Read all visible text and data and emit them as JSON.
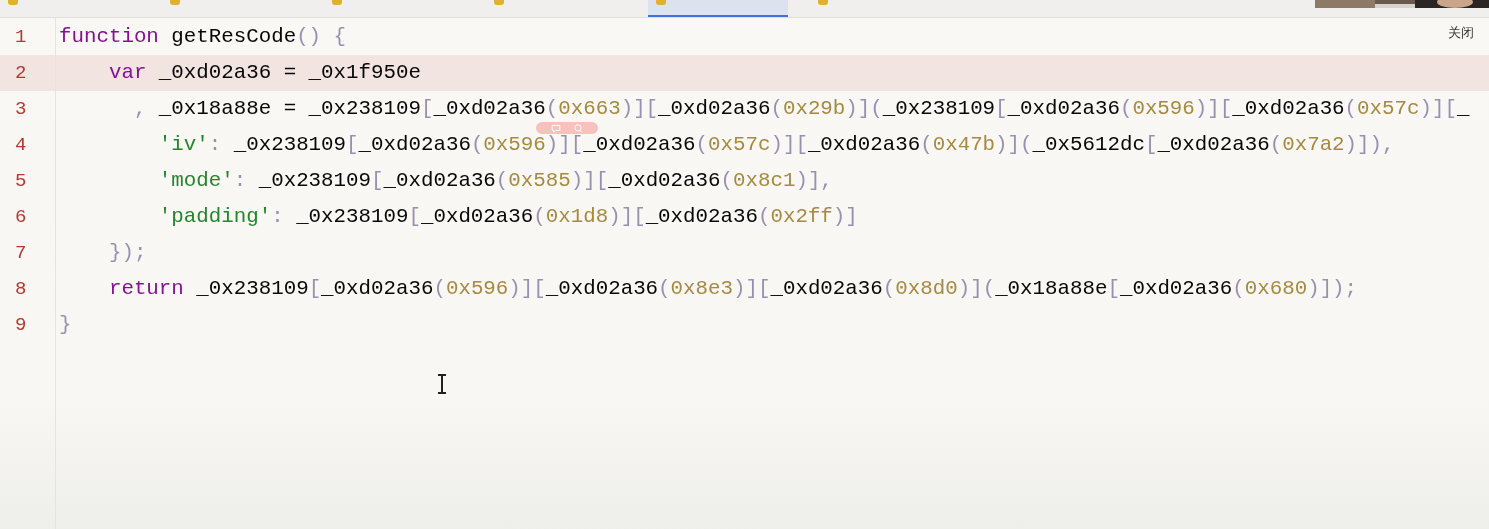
{
  "tabs": [
    {
      "selected": false
    },
    {
      "selected": false
    },
    {
      "selected": false
    },
    {
      "selected": false
    },
    {
      "selected": true
    },
    {
      "selected": false
    }
  ],
  "close_label": "关闭",
  "editor": {
    "lines": [
      {
        "number": "1",
        "current": false,
        "tokens": [
          {
            "kind": "keyword",
            "text": "function"
          },
          {
            "kind": "ident",
            "text": " getResCode"
          },
          {
            "kind": "punct",
            "text": "() {"
          }
        ]
      },
      {
        "number": "2",
        "current": true,
        "tokens": [
          {
            "kind": "keyword",
            "text": "    var"
          },
          {
            "kind": "ident",
            "text": " _0xd02a36 = _0x1f950e"
          }
        ]
      },
      {
        "number": "3",
        "current": false,
        "tokens": [
          {
            "kind": "punct",
            "text": "      ,"
          },
          {
            "kind": "ident",
            "text": " _0x18a88e = _0x238109"
          },
          {
            "kind": "punct",
            "text": "["
          },
          {
            "kind": "ident",
            "text": "_0xd02a36"
          },
          {
            "kind": "punct",
            "text": "("
          },
          {
            "kind": "number",
            "text": "0x663"
          },
          {
            "kind": "punct",
            "text": ")]["
          },
          {
            "kind": "ident",
            "text": "_0xd02a36"
          },
          {
            "kind": "punct",
            "text": "("
          },
          {
            "kind": "number",
            "text": "0x29b"
          },
          {
            "kind": "punct",
            "text": ")]("
          },
          {
            "kind": "ident",
            "text": "_0x238109"
          },
          {
            "kind": "punct",
            "text": "["
          },
          {
            "kind": "ident",
            "text": "_0xd02a36"
          },
          {
            "kind": "punct",
            "text": "("
          },
          {
            "kind": "number",
            "text": "0x596"
          },
          {
            "kind": "punct",
            "text": ")]["
          },
          {
            "kind": "ident",
            "text": "_0xd02a36"
          },
          {
            "kind": "punct",
            "text": "("
          },
          {
            "kind": "number",
            "text": "0x57c"
          },
          {
            "kind": "punct",
            "text": ")]["
          },
          {
            "kind": "ident",
            "text": "_"
          }
        ]
      },
      {
        "number": "4",
        "current": false,
        "tokens": [
          {
            "kind": "string",
            "text": "        'iv'"
          },
          {
            "kind": "punct",
            "text": ":"
          },
          {
            "kind": "ident",
            "text": " _0x238109"
          },
          {
            "kind": "punct",
            "text": "["
          },
          {
            "kind": "ident",
            "text": "_0xd02a36"
          },
          {
            "kind": "punct",
            "text": "("
          },
          {
            "kind": "number",
            "text": "0x596"
          },
          {
            "kind": "punct",
            "text": ")]["
          },
          {
            "kind": "ident",
            "text": "_0xd02a36"
          },
          {
            "kind": "punct",
            "text": "("
          },
          {
            "kind": "number",
            "text": "0x57c"
          },
          {
            "kind": "punct",
            "text": ")]["
          },
          {
            "kind": "ident",
            "text": "_0xd02a36"
          },
          {
            "kind": "punct",
            "text": "("
          },
          {
            "kind": "number",
            "text": "0x47b"
          },
          {
            "kind": "punct",
            "text": ")]("
          },
          {
            "kind": "ident",
            "text": "_0x5612dc"
          },
          {
            "kind": "punct",
            "text": "["
          },
          {
            "kind": "ident",
            "text": "_0xd02a36"
          },
          {
            "kind": "punct",
            "text": "("
          },
          {
            "kind": "number",
            "text": "0x7a2"
          },
          {
            "kind": "punct",
            "text": ")]),"
          }
        ]
      },
      {
        "number": "5",
        "current": false,
        "tokens": [
          {
            "kind": "string",
            "text": "        'mode'"
          },
          {
            "kind": "punct",
            "text": ":"
          },
          {
            "kind": "ident",
            "text": " _0x238109"
          },
          {
            "kind": "punct",
            "text": "["
          },
          {
            "kind": "ident",
            "text": "_0xd02a36"
          },
          {
            "kind": "punct",
            "text": "("
          },
          {
            "kind": "number",
            "text": "0x585"
          },
          {
            "kind": "punct",
            "text": ")]["
          },
          {
            "kind": "ident",
            "text": "_0xd02a36"
          },
          {
            "kind": "punct",
            "text": "("
          },
          {
            "kind": "number",
            "text": "0x8c1"
          },
          {
            "kind": "punct",
            "text": ")],"
          }
        ]
      },
      {
        "number": "6",
        "current": false,
        "tokens": [
          {
            "kind": "string",
            "text": "        'padding'"
          },
          {
            "kind": "punct",
            "text": ":"
          },
          {
            "kind": "ident",
            "text": " _0x238109"
          },
          {
            "kind": "punct",
            "text": "["
          },
          {
            "kind": "ident",
            "text": "_0xd02a36"
          },
          {
            "kind": "punct",
            "text": "("
          },
          {
            "kind": "number",
            "text": "0x1d8"
          },
          {
            "kind": "punct",
            "text": ")]["
          },
          {
            "kind": "ident",
            "text": "_0xd02a36"
          },
          {
            "kind": "punct",
            "text": "("
          },
          {
            "kind": "number",
            "text": "0x2ff"
          },
          {
            "kind": "punct",
            "text": ")]"
          }
        ]
      },
      {
        "number": "7",
        "current": false,
        "tokens": [
          {
            "kind": "punct",
            "text": "    });"
          }
        ]
      },
      {
        "number": "8",
        "current": false,
        "tokens": [
          {
            "kind": "keyword",
            "text": "    return"
          },
          {
            "kind": "ident",
            "text": " _0x238109"
          },
          {
            "kind": "punct",
            "text": "["
          },
          {
            "kind": "ident",
            "text": "_0xd02a36"
          },
          {
            "kind": "punct",
            "text": "("
          },
          {
            "kind": "number",
            "text": "0x596"
          },
          {
            "kind": "punct",
            "text": ")]["
          },
          {
            "kind": "ident",
            "text": "_0xd02a36"
          },
          {
            "kind": "punct",
            "text": "("
          },
          {
            "kind": "number",
            "text": "0x8e3"
          },
          {
            "kind": "punct",
            "text": ")]["
          },
          {
            "kind": "ident",
            "text": "_0xd02a36"
          },
          {
            "kind": "punct",
            "text": "("
          },
          {
            "kind": "number",
            "text": "0x8d0"
          },
          {
            "kind": "punct",
            "text": ")]("
          },
          {
            "kind": "ident",
            "text": "_0x18a88e"
          },
          {
            "kind": "punct",
            "text": "["
          },
          {
            "kind": "ident",
            "text": "_0xd02a36"
          },
          {
            "kind": "punct",
            "text": "("
          },
          {
            "kind": "number",
            "text": "0x680"
          },
          {
            "kind": "punct",
            "text": ")]);"
          }
        ]
      },
      {
        "number": "9",
        "current": false,
        "tokens": [
          {
            "kind": "punct",
            "text": "}"
          }
        ]
      }
    ]
  }
}
